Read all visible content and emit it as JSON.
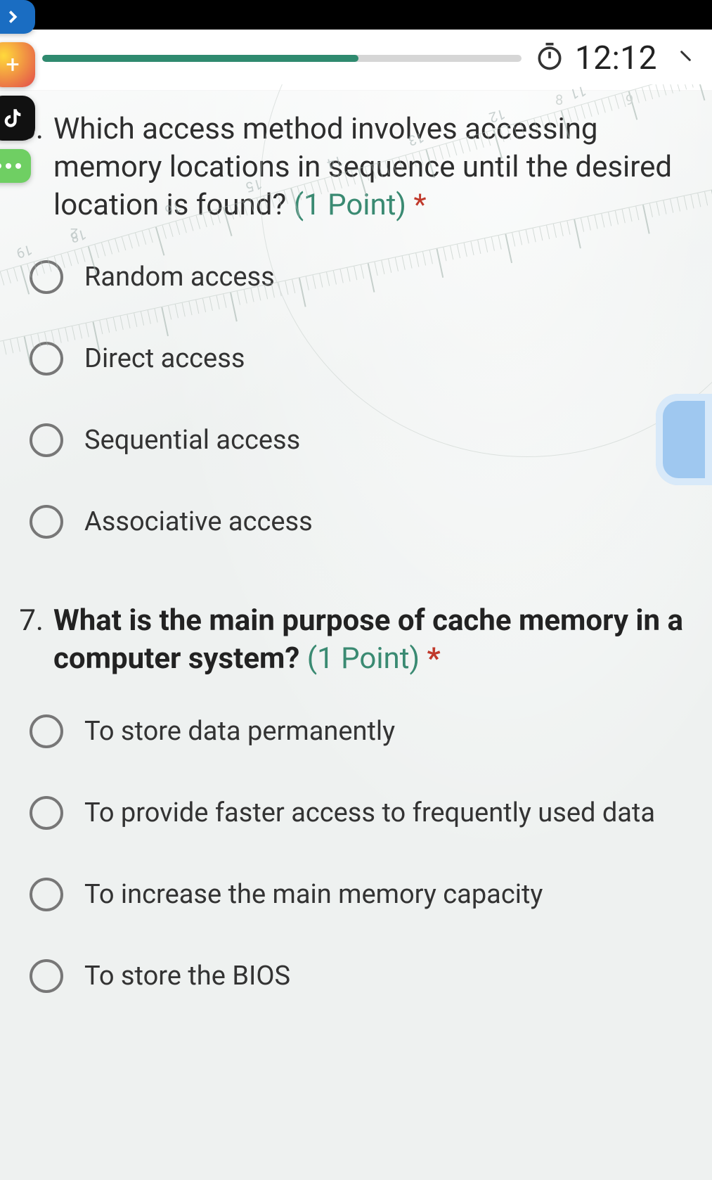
{
  "header": {
    "progress_percent": 66,
    "timer": "12:12"
  },
  "questions": [
    {
      "number": "6.",
      "text": "Which access method involves accessing memory locations in sequence until the desired location is found?",
      "points_label": "(1 Point)",
      "required_mark": "*",
      "bold": false,
      "options": [
        "Random access",
        "Direct access",
        "Sequential access",
        "Associative access"
      ]
    },
    {
      "number": "7.",
      "text": "What is the main purpose of cache memory in a computer system?",
      "points_label": "(1 Point)",
      "required_mark": "*",
      "bold": true,
      "options": [
        "To store data permanently",
        "To provide faster access to frequently used data",
        "To increase the main memory capacity",
        "To store the BIOS"
      ]
    }
  ],
  "ruler_numbers": [
    "8",
    "9",
    "11",
    "12",
    "13",
    "14",
    "15",
    "16",
    "18",
    "19",
    "2"
  ]
}
